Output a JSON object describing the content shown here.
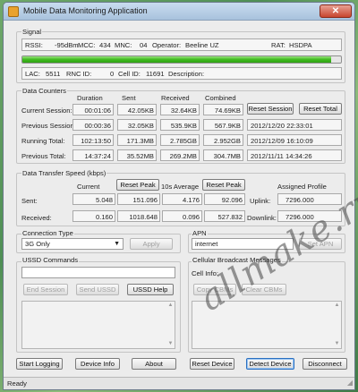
{
  "window": {
    "title": "Mobile Data Monitoring Application",
    "close_glyph": "✕"
  },
  "signal": {
    "group_label": "Signal",
    "rssi_label": "RSSI:",
    "rssi_value": "-95dBm",
    "mcc_label": "MCC:",
    "mcc_value": "434",
    "mnc_label": "MNC:",
    "mnc_value": "04",
    "operator_label": "Operator:",
    "operator_value": "Beeline UZ",
    "rat_label": "RAT:",
    "rat_value": "HSDPA",
    "strength_fraction": 0.97,
    "lac_label": "LAC:",
    "lac_value": "5511",
    "rnc_label": "RNC ID:",
    "rnc_value": "0",
    "cellid_label": "Cell ID:",
    "cellid_value": "11691",
    "description_label": "Description:",
    "description_value": ""
  },
  "counters": {
    "group_label": "Data Counters",
    "headers": {
      "duration": "Duration",
      "sent": "Sent",
      "received": "Received",
      "combined": "Combined"
    },
    "rows": [
      {
        "label": "Current Session:",
        "duration": "00:01:06",
        "sent": "42.05KB",
        "received": "32.64KB",
        "combined": "74.69KB"
      },
      {
        "label": "Previous Session:",
        "duration": "00:00:36",
        "sent": "32.05KB",
        "received": "535.9KB",
        "combined": "567.9KB",
        "date": "2012/12/20 22:33:01"
      },
      {
        "label": "Running Total:",
        "duration": "102:13:50",
        "sent": "171.3MB",
        "received": "2.785GB",
        "combined": "2.952GB",
        "date": "2012/12/09 16:10:09"
      },
      {
        "label": "Previous Total:",
        "duration": "14:37:24",
        "sent": "35.52MB",
        "received": "269.2MB",
        "combined": "304.7MB",
        "date": "2012/11/11 14:34:26"
      }
    ],
    "reset_session": "Reset Session",
    "reset_total": "Reset Total"
  },
  "speed": {
    "group_label": "Data Transfer Speed (kbps)",
    "current_header": "Current",
    "average_header": "10s Average",
    "reset_peak": "Reset Peak",
    "profile_header": "Assigned Profile",
    "sent_label": "Sent:",
    "sent_current": "5.048",
    "sent_peak": "151.096",
    "sent_avg": "4.176",
    "sent_avg_peak": "92.096",
    "received_label": "Received:",
    "received_current": "0.160",
    "received_peak": "1018.648",
    "received_avg": "0.096",
    "received_avg_peak": "527.832",
    "uplink_label": "Uplink:",
    "uplink_value": "7296.000",
    "downlink_label": "Downlink:",
    "downlink_value": "7296.000"
  },
  "connection": {
    "group_label": "Connection Type",
    "selected": "3G Only",
    "apply_label": "Apply"
  },
  "apn": {
    "group_label": "APN",
    "value": "internet",
    "set_label": "Set APN"
  },
  "ussd": {
    "group_label": "USSD Commands",
    "input_value": "",
    "end_session": "End Session",
    "send_ussd": "Send USSD",
    "ussd_help": "USSD Help"
  },
  "broadcast": {
    "group_label": "Cellular Broadcast Messages",
    "cellinfo_label": "Cell Info:",
    "copy_cbms": "Copy CBMs",
    "clear_cbms": "Clear CBMs"
  },
  "bottom_buttons": {
    "start_logging": "Start Logging",
    "device_info": "Device Info",
    "about": "About",
    "reset_device": "Reset Device",
    "detect_device": "Detect Device",
    "disconnect": "Disconnect"
  },
  "status": {
    "text": "Ready"
  },
  "watermark": {
    "text": "allmake.ru"
  }
}
